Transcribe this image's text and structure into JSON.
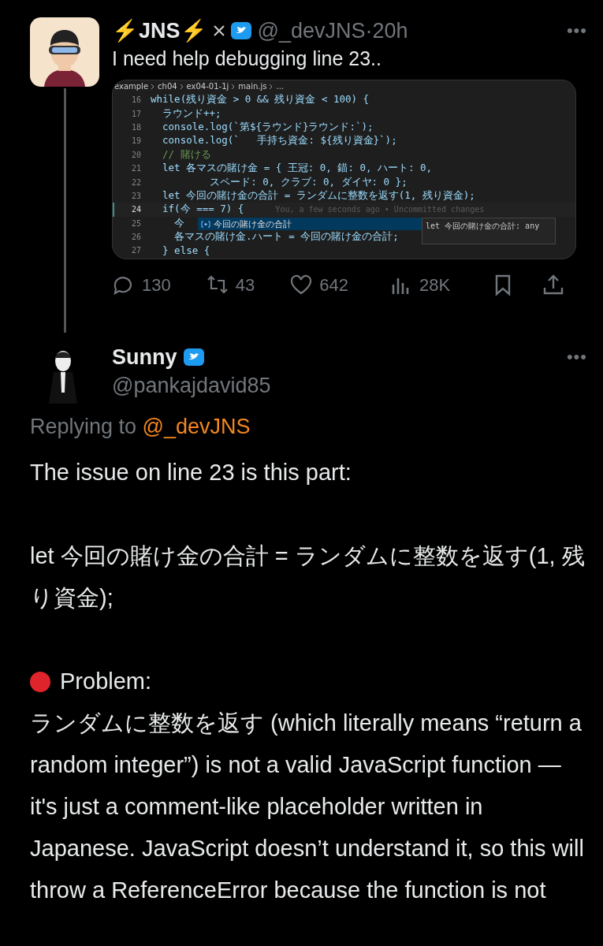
{
  "tweet": {
    "display_name": "⚡JNS⚡",
    "verified": true,
    "more": "•••",
    "handle": "@_devJNS",
    "separator": "·",
    "time": "20h",
    "text": "I need help debugging line 23..",
    "code_image": {
      "breadcrumb": [
        "example",
        "ch04",
        "ex04-01-1j",
        "main.js",
        "..."
      ],
      "lines": [
        {
          "number": "16",
          "kind": "code",
          "text": "while(残り資金 > 0 && 残り資金 < 100) {",
          "current": false
        },
        {
          "number": "17",
          "kind": "code",
          "text": "  ラウンド++;",
          "current": false
        },
        {
          "number": "18",
          "kind": "code",
          "text": "  console.log(`第${ラウンド}ラウンド:`);",
          "current": false
        },
        {
          "number": "19",
          "kind": "code",
          "text": "  console.log(`   手持ち資金: ${残り資金}`);",
          "current": false
        },
        {
          "number": "20",
          "kind": "comment",
          "text": "  // 賭ける",
          "current": false
        },
        {
          "number": "21",
          "kind": "code",
          "text": "  let 各マスの賭け金 = { 王冠: 0, 錨: 0, ハート: 0,",
          "current": false
        },
        {
          "number": "22",
          "kind": "code",
          "text": "          スペード: 0, クラブ: 0, ダイヤ: 0 };",
          "current": false
        },
        {
          "number": "23",
          "kind": "code",
          "text": "  let 今回の賭け金の合計 = ランダムに整数を返す(1, 残り資金);",
          "current": false
        },
        {
          "number": "24",
          "kind": "code",
          "text": "  if(今 === 7) {",
          "current": true,
          "blame": "You, a few seconds ago • Uncommitted changes"
        },
        {
          "number": "25",
          "kind": "code",
          "text": "    今",
          "current": false
        },
        {
          "number": "26",
          "kind": "code",
          "text": "    各マスの賭け金.ハート = 今回の賭け金の合計;",
          "current": false
        },
        {
          "number": "27",
          "kind": "code",
          "text": "  } else {",
          "current": false
        }
      ],
      "suggestion": {
        "item": "今回の賭け金の合計",
        "selected": true,
        "detail": "let 今回の賭け金の合計: any"
      }
    },
    "actions": [
      {
        "kind": "reply",
        "count": "130"
      },
      {
        "kind": "retweet",
        "count": "43"
      },
      {
        "kind": "like",
        "count": "642"
      },
      {
        "kind": "views",
        "count": "28K"
      },
      {
        "kind": "bookmark"
      },
      {
        "kind": "share"
      }
    ]
  },
  "reply": {
    "display_name": "Sunny",
    "verified": true,
    "more": "•••",
    "handle": "@pankajdavid85",
    "replying_label": "Replying to",
    "replying_to": "@_devJNS",
    "paragraphs": [
      {
        "kind": "text",
        "text": "The issue on line 23 is this part:"
      },
      {
        "kind": "text",
        "text": "let 今回の賭け金の合計 = ランダムに整数を返す(1, 残り資金);"
      },
      {
        "kind": "heading",
        "text": "Problem:"
      },
      {
        "kind": "text",
        "text": "ランダムに整数を返す (which literally means “return a random integer”) is not a valid JavaScript function — it's just a comment-like placeholder written in Japanese. JavaScript doesn’t understand it, so this will throw a ReferenceError because the function is not"
      }
    ]
  }
}
